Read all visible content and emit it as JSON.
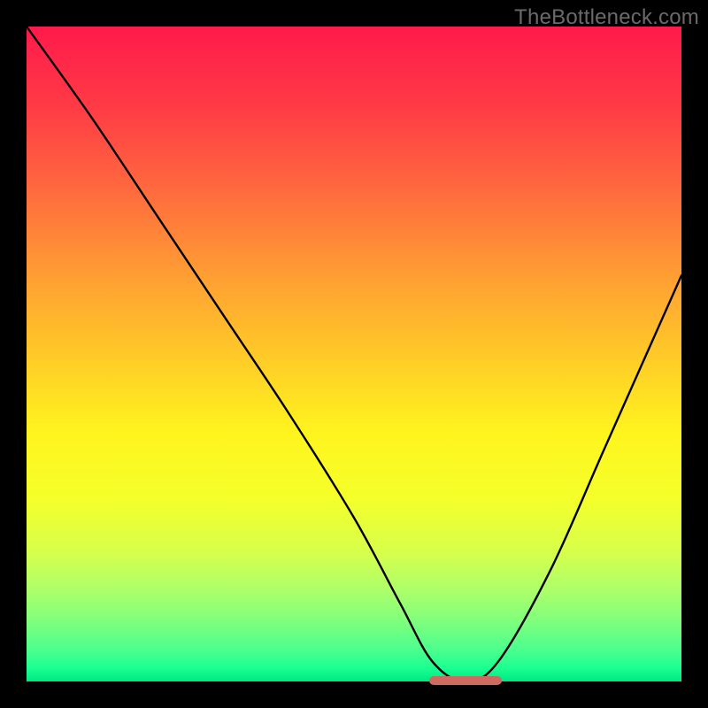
{
  "watermark": "TheBottleneck.com",
  "chart_data": {
    "type": "line",
    "title": "",
    "xlabel": "",
    "ylabel": "",
    "xlim": [
      0,
      100
    ],
    "ylim": [
      0,
      100
    ],
    "background_gradient": {
      "top_color": "#ff1a4b",
      "mid_color": "#fff41e",
      "bottom_color": "#00e884",
      "meaning": "red=high bottleneck, green=optimal"
    },
    "series": [
      {
        "name": "bottleneck-curve",
        "x": [
          0,
          10,
          20,
          30,
          40,
          50,
          57,
          62,
          67,
          72,
          80,
          88,
          96,
          100
        ],
        "values": [
          100,
          86,
          71,
          56,
          41,
          25,
          12,
          3,
          0,
          3,
          17,
          35,
          53,
          62
        ]
      }
    ],
    "optimal_flat_region": {
      "x_start": 62,
      "x_end": 72,
      "y": 0
    },
    "annotations": []
  }
}
